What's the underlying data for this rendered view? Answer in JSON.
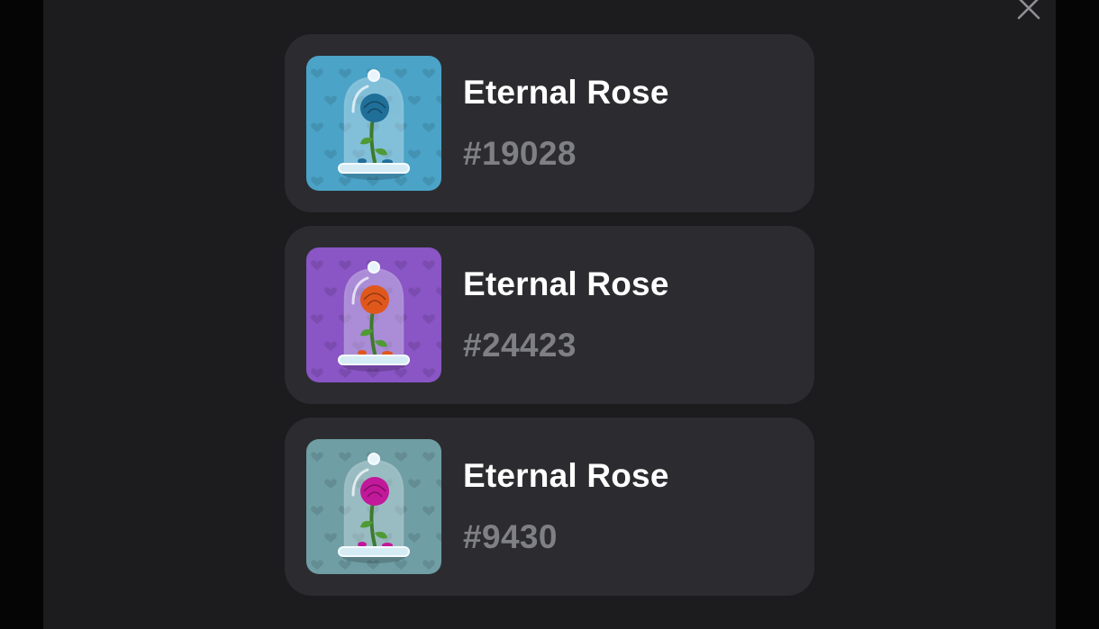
{
  "close_button": {
    "icon": "close-icon"
  },
  "gifts": [
    {
      "name": "Eternal Rose",
      "number": "#19028",
      "icon": "rose-in-glass-dome-icon",
      "bg_color": "#4ba3c7",
      "rose_color": "#1f6f99"
    },
    {
      "name": "Eternal Rose",
      "number": "#24423",
      "icon": "rose-in-glass-dome-icon",
      "bg_color": "#8a55c4",
      "rose_color": "#e0571c"
    },
    {
      "name": "Eternal Rose",
      "number": "#9430",
      "icon": "rose-in-glass-dome-icon",
      "bg_color": "#6f9ea4",
      "rose_color": "#c2189a"
    }
  ]
}
